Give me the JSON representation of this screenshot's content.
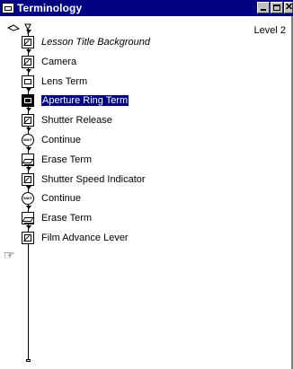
{
  "window": {
    "title": "Terminology"
  },
  "level_label": "Level 2",
  "icons": [
    {
      "type": "display",
      "label": "Lesson Title Background",
      "italic": true,
      "selected": false
    },
    {
      "type": "display",
      "label": "Camera",
      "italic": false,
      "selected": false
    },
    {
      "type": "map",
      "label": "Lens Term",
      "italic": false,
      "selected": false
    },
    {
      "type": "map-dark",
      "label": "Aperture Ring Term",
      "italic": false,
      "selected": true
    },
    {
      "type": "display",
      "label": "Shutter Release",
      "italic": false,
      "selected": false
    },
    {
      "type": "wait",
      "label": "Continue",
      "italic": false,
      "selected": false
    },
    {
      "type": "erase",
      "label": "Erase Term",
      "italic": false,
      "selected": false
    },
    {
      "type": "display",
      "label": "Shutter Speed Indicator",
      "italic": false,
      "selected": false
    },
    {
      "type": "wait",
      "label": "Continue",
      "italic": false,
      "selected": false
    },
    {
      "type": "erase",
      "label": "Erase Term",
      "italic": false,
      "selected": false
    },
    {
      "type": "display",
      "label": "Film Advance Lever",
      "italic": false,
      "selected": false
    }
  ],
  "wait_icon_text": "WAIT",
  "icon_names": {
    "display": "display-icon",
    "map": "map-icon",
    "map-dark": "map-icon-selected",
    "wait": "wait-icon",
    "erase": "erase-icon"
  }
}
